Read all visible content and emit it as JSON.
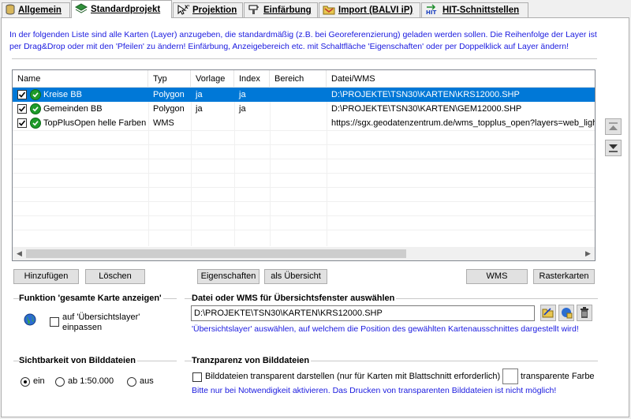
{
  "tabs": [
    {
      "label": "Allgemein",
      "icon": "database-icon",
      "active": false
    },
    {
      "label": "Standardprojekt",
      "icon": "layers-icon",
      "active": true
    },
    {
      "label": "Projektion",
      "icon": "projection-icon",
      "active": false
    },
    {
      "label": "Einfärbung",
      "icon": "paint-icon",
      "active": false
    },
    {
      "label": "Import (BALVI iP)",
      "icon": "folder-icon",
      "active": false
    },
    {
      "label": "HIT-Schnittstellen",
      "icon": "hit-icon",
      "active": false
    }
  ],
  "info_text": "In der folgenden Liste sind alle Karten (Layer) anzugeben, die standardmäßig (z.B. bei Georeferenzierung) geladen werden sollen. Die Reihenfolge der Layer ist per Drag&Drop oder mit den 'Pfeilen' zu ändern! Einfärbung, Anzeigebereich etc. mit Schaltfläche 'Eigenschaften' oder per Doppelklick auf Layer ändern!",
  "layer_list": {
    "columns": [
      "Name",
      "Typ",
      "Vorlage",
      "Index",
      "Bereich",
      "Datei/WMS"
    ],
    "rows": [
      {
        "name": "Kreise BB",
        "typ": "Polygon",
        "vorlage": "ja",
        "index": "ja",
        "bereich": "",
        "datei": "D:\\PROJEKTE\\TSN30\\KARTEN\\KRS12000.SHP",
        "selected": true,
        "checked": true
      },
      {
        "name": "Gemeinden BB",
        "typ": "Polygon",
        "vorlage": "ja",
        "index": "ja",
        "bereich": "",
        "datei": "D:\\PROJEKTE\\TSN30\\KARTEN\\GEM12000.SHP",
        "selected": false,
        "checked": true
      },
      {
        "name": "TopPlusOpen helle Farben",
        "typ": "WMS",
        "vorlage": "",
        "index": "",
        "bereich": "",
        "datei": "https://sgx.geodatenzentrum.de/wms_topplus_open?layers=web_light",
        "selected": false,
        "checked": true
      }
    ]
  },
  "buttons": {
    "add": "Hinzufügen",
    "delete": "Löschen",
    "properties": "Eigenschaften",
    "as_overview": "als Übersicht",
    "wms": "WMS",
    "raster": "Rasterkarten"
  },
  "group_full_map": {
    "title": "Funktion 'gesamte Karte anzeigen'",
    "checkbox_label_line1": "auf 'Übersichtslayer'",
    "checkbox_label_line2": "einpassen",
    "checked": false
  },
  "group_overview_file": {
    "title": "Datei oder WMS für Übersichtsfenster auswählen",
    "value": "D:\\PROJEKTE\\TSN30\\KARTEN\\KRS12000.SHP",
    "note": "'Übersichtslayer' auswählen, auf welchem die Position des gewählten Kartenausschnittes dargestellt wird!"
  },
  "group_visibility": {
    "title": "Sichtbarkeit von Bilddateien",
    "options": [
      "ein",
      "ab 1:50.000",
      "aus"
    ],
    "selected": "ein"
  },
  "group_transparency": {
    "title": "Tranzparenz von Bilddateien",
    "checkbox_label": "Bilddateien transparent darstellen (nur für Karten mit Blattschnitt erforderlich)",
    "color_label": "transparente Farbe",
    "checked": false,
    "note": "Bitte nur bei Notwendigkeit aktivieren. Das Drucken von transparenten Bilddateien ist nicht möglich!"
  },
  "colors": {
    "accent": "#0078d7",
    "note_blue": "#1a1adf",
    "ok_green": "#1e9b2a"
  }
}
